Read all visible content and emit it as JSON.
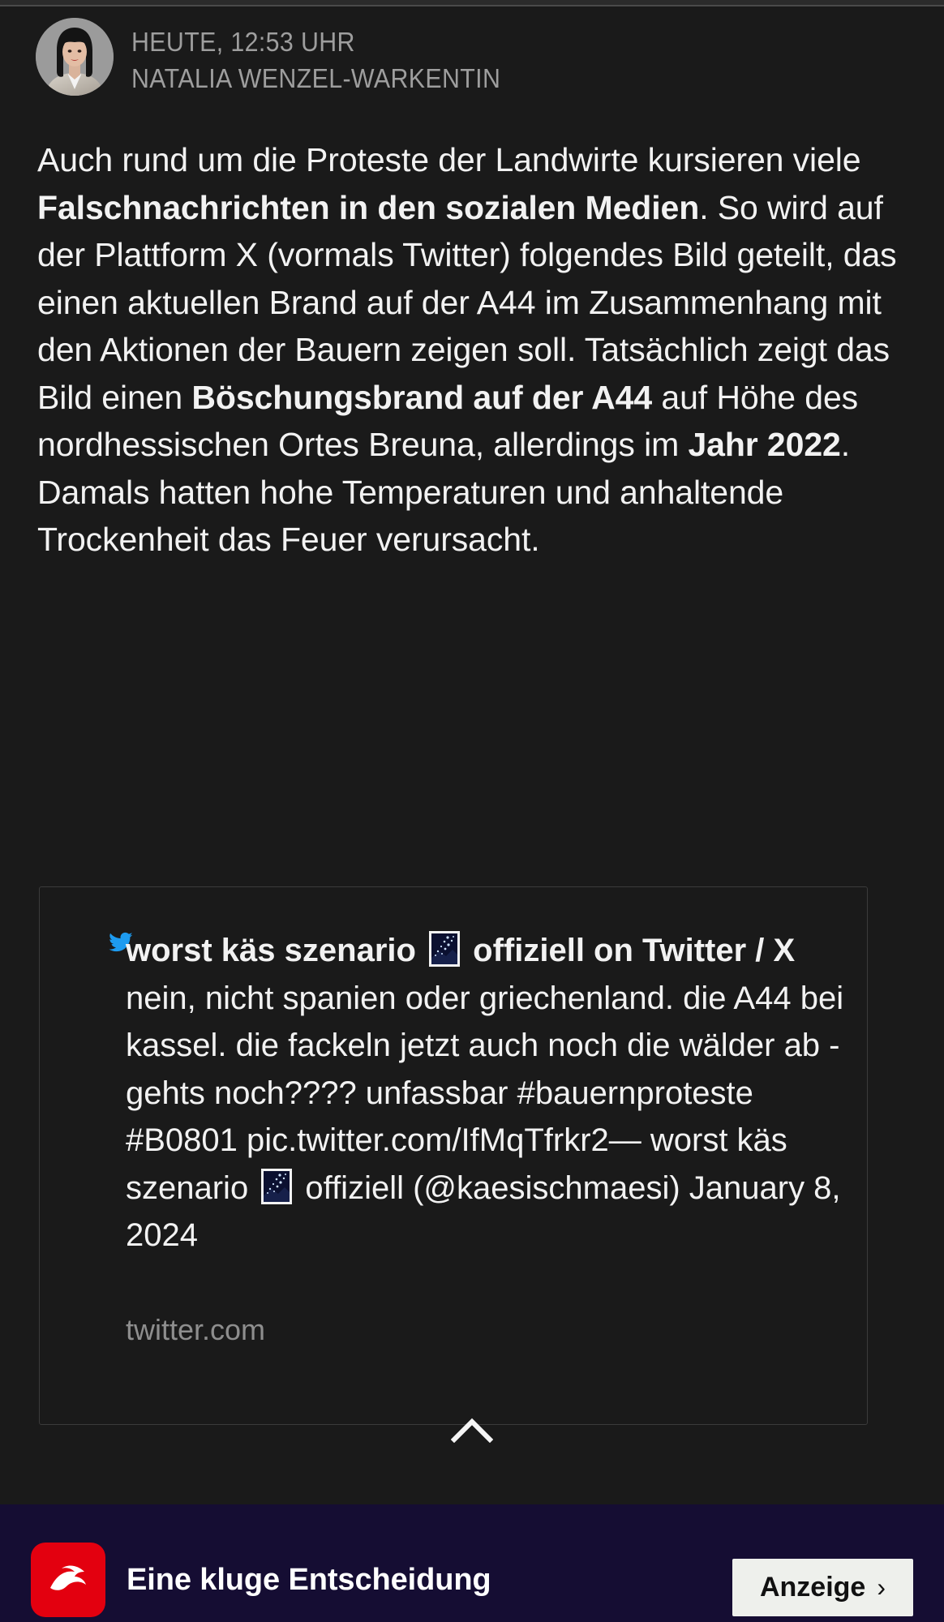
{
  "post": {
    "timestamp": "HEUTE, 12:53 UHR",
    "author": "NATALIA WENZEL-WARKENTIN",
    "avatar_alt": "author-portrait"
  },
  "article": {
    "paragraph_segments": [
      {
        "text": "Auch rund um die Proteste der Landwirte kursieren viele ",
        "bold": false
      },
      {
        "text": "Falschnachrichten in den sozialen Medien",
        "bold": true
      },
      {
        "text": ". So wird auf der Plattform X (vormals Twitter) folgendes Bild geteilt, das einen aktuellen Brand auf der A44 im Zusammenhang mit den Aktionen der Bauern zeigen soll. Tatsächlich zeigt das Bild einen ",
        "bold": false
      },
      {
        "text": "Böschungsbrand auf der A44",
        "bold": true
      },
      {
        "text": " auf Höhe des nordhessischen Ortes Breuna, allerdings im ",
        "bold": false
      },
      {
        "text": "Jahr 2022",
        "bold": true
      },
      {
        "text": ". Damals hatten hohe Temperaturen und anhaltende Trockenheit das Feuer verursacht.",
        "bold": false
      }
    ]
  },
  "tweet_card": {
    "platform_icon": "twitter-bird-icon",
    "account_title": "worst käs szenario",
    "account_title_suffix": "offiziell on Twitter / X",
    "emoji": "milky-way-emoji",
    "body": "nein, nicht spanien oder griechenland. die A44 bei kassel. die fackeln jetzt auch noch die wälder ab - gehts noch???? unfassbar #bauernproteste #B0801 pic.twitter.com/IfMqTfrkr2— worst käs",
    "attribution_prefix": "szenario",
    "attribution_suffix": "offiziell (@kaesischmaesi)",
    "date": "January 8, 2024",
    "source": "twitter.com"
  },
  "controls": {
    "collapse_label": "chevron-up-icon"
  },
  "promo": {
    "logo_alt": "brand-logo",
    "headline": "Eine kluge Entscheidung",
    "cta_label": "Anzeige",
    "cta_arrow": "›"
  },
  "colors": {
    "page_background": "#1a1a1a",
    "text_primary": "#f2f2f2",
    "text_muted": "#9e9e9e",
    "card_border": "#3b3b3b",
    "twitter_blue": "#1d9bf0",
    "promo_background": "#150d33",
    "promo_accent": "#e3000f",
    "cta_background": "#eef0ec"
  }
}
